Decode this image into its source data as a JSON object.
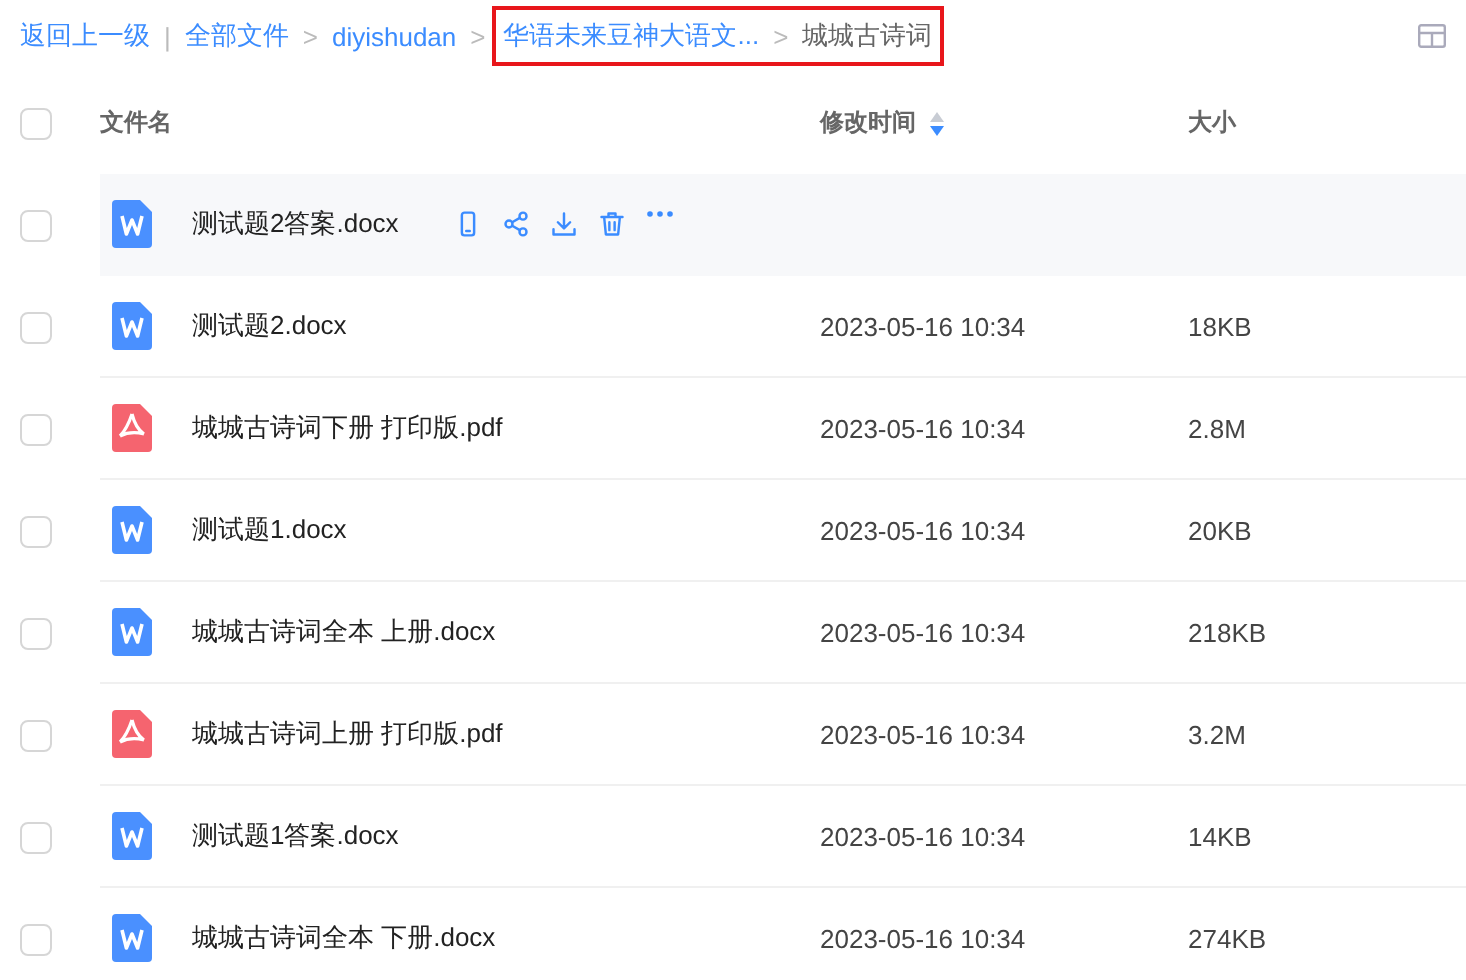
{
  "breadcrumbs": [
    {
      "label": "返回上一级",
      "kind": "back",
      "highlighted": false
    },
    {
      "label": "全部文件",
      "kind": "link",
      "highlighted": false
    },
    {
      "label": "diyishudan",
      "kind": "link",
      "highlighted": false
    },
    {
      "label": "华语未来豆神大语文...",
      "kind": "link",
      "highlighted": true
    },
    {
      "label": "城城古诗词",
      "kind": "current",
      "highlighted": true
    }
  ],
  "separators": {
    "bar": "|",
    "arrow": ">"
  },
  "select_all": {
    "checked": false
  },
  "columns": [
    {
      "label": "文件名",
      "sortable": false
    },
    {
      "label": "修改时间",
      "sortable": true
    },
    {
      "label": "大小",
      "sortable": false
    }
  ],
  "rows": [
    {
      "name": "测试题2答案.docx",
      "kind": "docx",
      "hovered": true,
      "checked": false
    },
    {
      "name": "测试题2.docx",
      "kind": "docx",
      "modified": "2023-05-16 10:34",
      "size": "18KB",
      "hovered": false,
      "checked": false
    },
    {
      "name": "城城古诗词下册 打印版.pdf",
      "kind": "pdf",
      "modified": "2023-05-16 10:34",
      "size": "2.8M",
      "hovered": false,
      "checked": false
    },
    {
      "name": "测试题1.docx",
      "kind": "docx",
      "modified": "2023-05-16 10:34",
      "size": "20KB",
      "hovered": false,
      "checked": false
    },
    {
      "name": "城城古诗词全本 上册.docx",
      "kind": "docx",
      "modified": "2023-05-16 10:34",
      "size": "218KB",
      "hovered": false,
      "checked": false
    },
    {
      "name": "城城古诗词上册 打印版.pdf",
      "kind": "pdf",
      "modified": "2023-05-16 10:34",
      "size": "3.2M",
      "hovered": false,
      "checked": false
    },
    {
      "name": "测试题1答案.docx",
      "kind": "docx",
      "modified": "2023-05-16 10:34",
      "size": "14KB",
      "hovered": false,
      "checked": false
    },
    {
      "name": "城城古诗词全本 下册.docx",
      "kind": "docx",
      "modified": "2023-05-16 10:34",
      "size": "274KB",
      "hovered": false,
      "checked": false
    }
  ]
}
